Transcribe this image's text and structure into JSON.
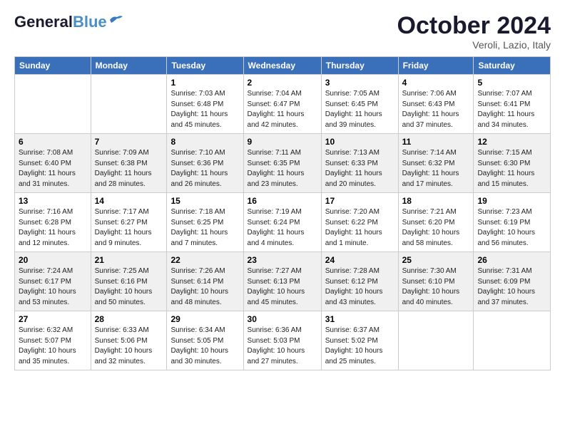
{
  "header": {
    "logo_general": "General",
    "logo_blue": "Blue",
    "month": "October 2024",
    "location": "Veroli, Lazio, Italy"
  },
  "weekdays": [
    "Sunday",
    "Monday",
    "Tuesday",
    "Wednesday",
    "Thursday",
    "Friday",
    "Saturday"
  ],
  "weeks": [
    [
      {
        "day": "",
        "detail": ""
      },
      {
        "day": "",
        "detail": ""
      },
      {
        "day": "1",
        "detail": "Sunrise: 7:03 AM\nSunset: 6:48 PM\nDaylight: 11 hours\nand 45 minutes."
      },
      {
        "day": "2",
        "detail": "Sunrise: 7:04 AM\nSunset: 6:47 PM\nDaylight: 11 hours\nand 42 minutes."
      },
      {
        "day": "3",
        "detail": "Sunrise: 7:05 AM\nSunset: 6:45 PM\nDaylight: 11 hours\nand 39 minutes."
      },
      {
        "day": "4",
        "detail": "Sunrise: 7:06 AM\nSunset: 6:43 PM\nDaylight: 11 hours\nand 37 minutes."
      },
      {
        "day": "5",
        "detail": "Sunrise: 7:07 AM\nSunset: 6:41 PM\nDaylight: 11 hours\nand 34 minutes."
      }
    ],
    [
      {
        "day": "6",
        "detail": "Sunrise: 7:08 AM\nSunset: 6:40 PM\nDaylight: 11 hours\nand 31 minutes."
      },
      {
        "day": "7",
        "detail": "Sunrise: 7:09 AM\nSunset: 6:38 PM\nDaylight: 11 hours\nand 28 minutes."
      },
      {
        "day": "8",
        "detail": "Sunrise: 7:10 AM\nSunset: 6:36 PM\nDaylight: 11 hours\nand 26 minutes."
      },
      {
        "day": "9",
        "detail": "Sunrise: 7:11 AM\nSunset: 6:35 PM\nDaylight: 11 hours\nand 23 minutes."
      },
      {
        "day": "10",
        "detail": "Sunrise: 7:13 AM\nSunset: 6:33 PM\nDaylight: 11 hours\nand 20 minutes."
      },
      {
        "day": "11",
        "detail": "Sunrise: 7:14 AM\nSunset: 6:32 PM\nDaylight: 11 hours\nand 17 minutes."
      },
      {
        "day": "12",
        "detail": "Sunrise: 7:15 AM\nSunset: 6:30 PM\nDaylight: 11 hours\nand 15 minutes."
      }
    ],
    [
      {
        "day": "13",
        "detail": "Sunrise: 7:16 AM\nSunset: 6:28 PM\nDaylight: 11 hours\nand 12 minutes."
      },
      {
        "day": "14",
        "detail": "Sunrise: 7:17 AM\nSunset: 6:27 PM\nDaylight: 11 hours\nand 9 minutes."
      },
      {
        "day": "15",
        "detail": "Sunrise: 7:18 AM\nSunset: 6:25 PM\nDaylight: 11 hours\nand 7 minutes."
      },
      {
        "day": "16",
        "detail": "Sunrise: 7:19 AM\nSunset: 6:24 PM\nDaylight: 11 hours\nand 4 minutes."
      },
      {
        "day": "17",
        "detail": "Sunrise: 7:20 AM\nSunset: 6:22 PM\nDaylight: 11 hours\nand 1 minute."
      },
      {
        "day": "18",
        "detail": "Sunrise: 7:21 AM\nSunset: 6:20 PM\nDaylight: 10 hours\nand 58 minutes."
      },
      {
        "day": "19",
        "detail": "Sunrise: 7:23 AM\nSunset: 6:19 PM\nDaylight: 10 hours\nand 56 minutes."
      }
    ],
    [
      {
        "day": "20",
        "detail": "Sunrise: 7:24 AM\nSunset: 6:17 PM\nDaylight: 10 hours\nand 53 minutes."
      },
      {
        "day": "21",
        "detail": "Sunrise: 7:25 AM\nSunset: 6:16 PM\nDaylight: 10 hours\nand 50 minutes."
      },
      {
        "day": "22",
        "detail": "Sunrise: 7:26 AM\nSunset: 6:14 PM\nDaylight: 10 hours\nand 48 minutes."
      },
      {
        "day": "23",
        "detail": "Sunrise: 7:27 AM\nSunset: 6:13 PM\nDaylight: 10 hours\nand 45 minutes."
      },
      {
        "day": "24",
        "detail": "Sunrise: 7:28 AM\nSunset: 6:12 PM\nDaylight: 10 hours\nand 43 minutes."
      },
      {
        "day": "25",
        "detail": "Sunrise: 7:30 AM\nSunset: 6:10 PM\nDaylight: 10 hours\nand 40 minutes."
      },
      {
        "day": "26",
        "detail": "Sunrise: 7:31 AM\nSunset: 6:09 PM\nDaylight: 10 hours\nand 37 minutes."
      }
    ],
    [
      {
        "day": "27",
        "detail": "Sunrise: 6:32 AM\nSunset: 5:07 PM\nDaylight: 10 hours\nand 35 minutes."
      },
      {
        "day": "28",
        "detail": "Sunrise: 6:33 AM\nSunset: 5:06 PM\nDaylight: 10 hours\nand 32 minutes."
      },
      {
        "day": "29",
        "detail": "Sunrise: 6:34 AM\nSunset: 5:05 PM\nDaylight: 10 hours\nand 30 minutes."
      },
      {
        "day": "30",
        "detail": "Sunrise: 6:36 AM\nSunset: 5:03 PM\nDaylight: 10 hours\nand 27 minutes."
      },
      {
        "day": "31",
        "detail": "Sunrise: 6:37 AM\nSunset: 5:02 PM\nDaylight: 10 hours\nand 25 minutes."
      },
      {
        "day": "",
        "detail": ""
      },
      {
        "day": "",
        "detail": ""
      }
    ]
  ]
}
